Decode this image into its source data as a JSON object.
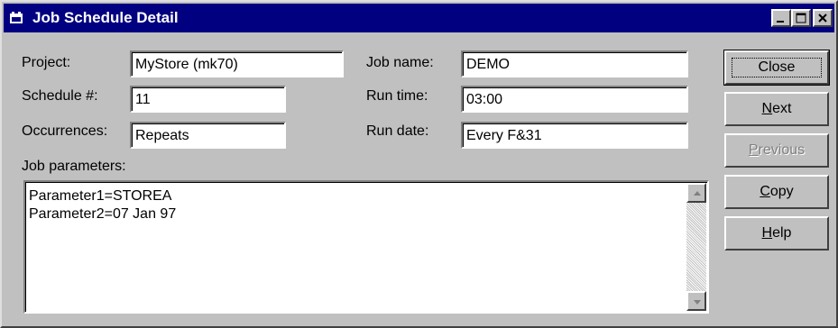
{
  "window": {
    "title": "Job Schedule Detail",
    "controls": {
      "minimize": "_",
      "maximize": "□",
      "close": "×"
    }
  },
  "form": {
    "project": {
      "label": "Project:",
      "value": "MyStore (mk70)"
    },
    "schedule": {
      "label": "Schedule #:",
      "value": "11"
    },
    "occurrences": {
      "label": "Occurrences:",
      "value": "Repeats"
    },
    "job_name": {
      "label": "Job name:",
      "value": "DEMO"
    },
    "run_time": {
      "label": "Run time:",
      "value": "03:00"
    },
    "run_date": {
      "label": "Run date:",
      "value": "Every F&31"
    },
    "job_parameters": {
      "label": "Job parameters:",
      "lines": [
        "Parameter1=STOREA",
        "Parameter2=07 Jan 97"
      ]
    }
  },
  "buttons": {
    "close": {
      "accel": "",
      "rest": "Close",
      "enabled": true,
      "default": true
    },
    "next": {
      "accel": "N",
      "rest": "ext",
      "enabled": true
    },
    "previous": {
      "accel": "P",
      "rest": "revious",
      "enabled": false
    },
    "copy": {
      "accel": "C",
      "rest": "opy",
      "enabled": true
    },
    "help": {
      "accel": "H",
      "rest": "elp",
      "enabled": true
    }
  },
  "colors": {
    "titlebar": "#000080",
    "face": "#c0c0c0",
    "disabled_text": "#808080"
  }
}
